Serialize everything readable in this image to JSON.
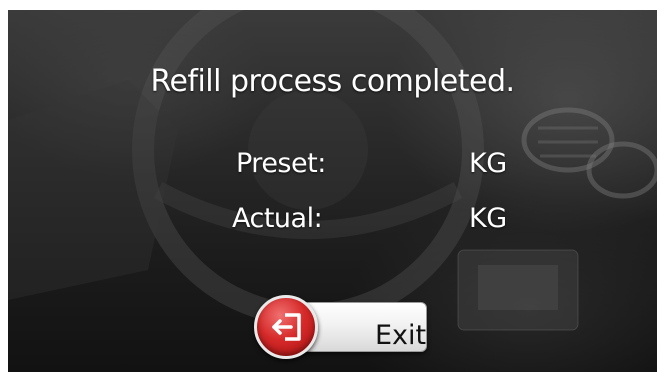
{
  "dialog": {
    "title": "Refill process completed.",
    "preset": {
      "label": "Preset:",
      "value": "",
      "unit": "KG"
    },
    "actual": {
      "label": "Actual:",
      "value": "",
      "unit": "KG"
    },
    "exit_button": {
      "label": "Exit",
      "icon": "exit-door-icon"
    }
  },
  "colors": {
    "text": "#ffffff",
    "exit_accent": "#d62a2a",
    "button_plate": "#f2f2f2"
  }
}
